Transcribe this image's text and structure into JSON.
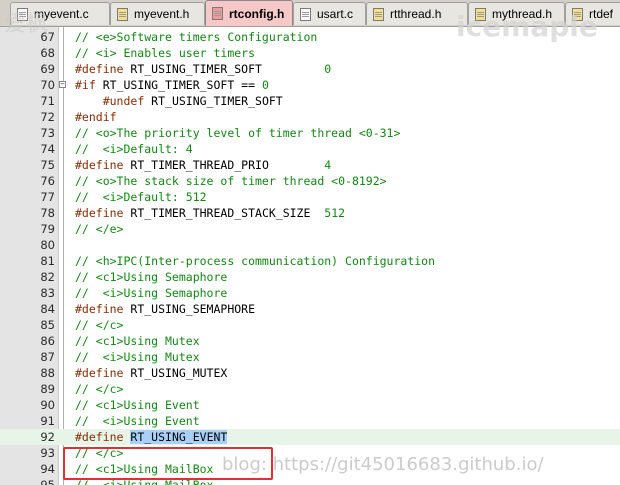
{
  "tabs": [
    {
      "label": "myevent.c",
      "type": "c"
    },
    {
      "label": "myevent.h",
      "type": "h"
    },
    {
      "label": "rtconfig.h",
      "type": "h",
      "active": true
    },
    {
      "label": "usart.c",
      "type": "c"
    },
    {
      "label": "rtthread.h",
      "type": "h"
    },
    {
      "label": "mythread.h",
      "type": "h"
    },
    {
      "label": "rtdef",
      "type": "h"
    }
  ],
  "editor": {
    "highlight_line": 92,
    "lines": [
      {
        "n": "67",
        "fold": "",
        "seg": [
          {
            "t": "// <e>Software timers Configuration",
            "c": "cm"
          }
        ]
      },
      {
        "n": "68",
        "fold": "",
        "seg": [
          {
            "t": "// <i> Enables user timers",
            "c": "cm"
          }
        ]
      },
      {
        "n": "69",
        "fold": "",
        "seg": [
          {
            "t": "#define",
            "c": "pp"
          },
          {
            "t": " RT_USING_TIMER_SOFT         ",
            "c": ""
          },
          {
            "t": "0",
            "c": "num"
          }
        ]
      },
      {
        "n": "70",
        "fold": "minus",
        "seg": [
          {
            "t": "#if",
            "c": "pp"
          },
          {
            "t": " RT_USING_TIMER_SOFT == ",
            "c": ""
          },
          {
            "t": "0",
            "c": "num"
          }
        ]
      },
      {
        "n": "71",
        "fold": "",
        "seg": [
          {
            "t": "    ",
            "c": ""
          },
          {
            "t": "#undef",
            "c": "pp"
          },
          {
            "t": " RT_USING_TIMER_SOFT",
            "c": ""
          }
        ]
      },
      {
        "n": "72",
        "fold": "",
        "seg": [
          {
            "t": "#endif",
            "c": "pp"
          }
        ]
      },
      {
        "n": "73",
        "fold": "",
        "seg": [
          {
            "t": "// <o>The priority level of timer thread <0-31>",
            "c": "cm"
          }
        ]
      },
      {
        "n": "74",
        "fold": "",
        "seg": [
          {
            "t": "//  <i>Default: 4",
            "c": "cm"
          }
        ]
      },
      {
        "n": "75",
        "fold": "",
        "seg": [
          {
            "t": "#define",
            "c": "pp"
          },
          {
            "t": " RT_TIMER_THREAD_PRIO        ",
            "c": ""
          },
          {
            "t": "4",
            "c": "num"
          }
        ]
      },
      {
        "n": "76",
        "fold": "",
        "seg": [
          {
            "t": "// <o>The stack size of timer thread <0-8192>",
            "c": "cm"
          }
        ]
      },
      {
        "n": "77",
        "fold": "",
        "seg": [
          {
            "t": "//  <i>Default: 512",
            "c": "cm"
          }
        ]
      },
      {
        "n": "78",
        "fold": "",
        "seg": [
          {
            "t": "#define",
            "c": "pp"
          },
          {
            "t": " RT_TIMER_THREAD_STACK_SIZE  ",
            "c": ""
          },
          {
            "t": "512",
            "c": "num"
          }
        ]
      },
      {
        "n": "79",
        "fold": "",
        "seg": [
          {
            "t": "// </e>",
            "c": "cm"
          }
        ]
      },
      {
        "n": "80",
        "fold": "",
        "seg": []
      },
      {
        "n": "81",
        "fold": "",
        "seg": [
          {
            "t": "// <h>IPC(Inter-process communication) Configuration",
            "c": "cm"
          }
        ]
      },
      {
        "n": "82",
        "fold": "",
        "seg": [
          {
            "t": "// <c1>Using Semaphore",
            "c": "cm"
          }
        ]
      },
      {
        "n": "83",
        "fold": "",
        "seg": [
          {
            "t": "//  <i>Using Semaphore",
            "c": "cm"
          }
        ]
      },
      {
        "n": "84",
        "fold": "",
        "seg": [
          {
            "t": "#define",
            "c": "pp"
          },
          {
            "t": " RT_USING_SEMAPHORE",
            "c": ""
          }
        ]
      },
      {
        "n": "85",
        "fold": "",
        "seg": [
          {
            "t": "// </c>",
            "c": "cm"
          }
        ]
      },
      {
        "n": "86",
        "fold": "",
        "seg": [
          {
            "t": "// <c1>Using Mutex",
            "c": "cm"
          }
        ]
      },
      {
        "n": "87",
        "fold": "",
        "seg": [
          {
            "t": "//  <i>Using Mutex",
            "c": "cm"
          }
        ]
      },
      {
        "n": "88",
        "fold": "",
        "seg": [
          {
            "t": "#define",
            "c": "pp"
          },
          {
            "t": " RT_USING_MUTEX",
            "c": ""
          }
        ]
      },
      {
        "n": "89",
        "fold": "",
        "seg": [
          {
            "t": "// </c>",
            "c": "cm"
          }
        ]
      },
      {
        "n": "90",
        "fold": "",
        "seg": [
          {
            "t": "// <c1>Using Event",
            "c": "cm"
          }
        ]
      },
      {
        "n": "91",
        "fold": "",
        "seg": [
          {
            "t": "//  <i>Using Event",
            "c": "cm"
          }
        ]
      },
      {
        "n": "92",
        "fold": "",
        "seg": [
          {
            "t": "#define",
            "c": "pp"
          },
          {
            "t": " ",
            "c": ""
          },
          {
            "t": "RT_USING_EVENT",
            "c": "sel"
          }
        ]
      },
      {
        "n": "93",
        "fold": "",
        "seg": [
          {
            "t": "// </c>",
            "c": "cm"
          }
        ]
      },
      {
        "n": "94",
        "fold": "",
        "seg": [
          {
            "t": "// <c1>Using MailBox",
            "c": "cm"
          }
        ]
      },
      {
        "n": "95",
        "fold": "",
        "seg": [
          {
            "t": "//  <i>Using MailBox",
            "c": "cm"
          }
        ]
      }
    ]
  },
  "watermarks": {
    "top_right": "icemaple",
    "top_left": "爱枫",
    "bottom": "blog: https://git45016683.github.io/"
  }
}
